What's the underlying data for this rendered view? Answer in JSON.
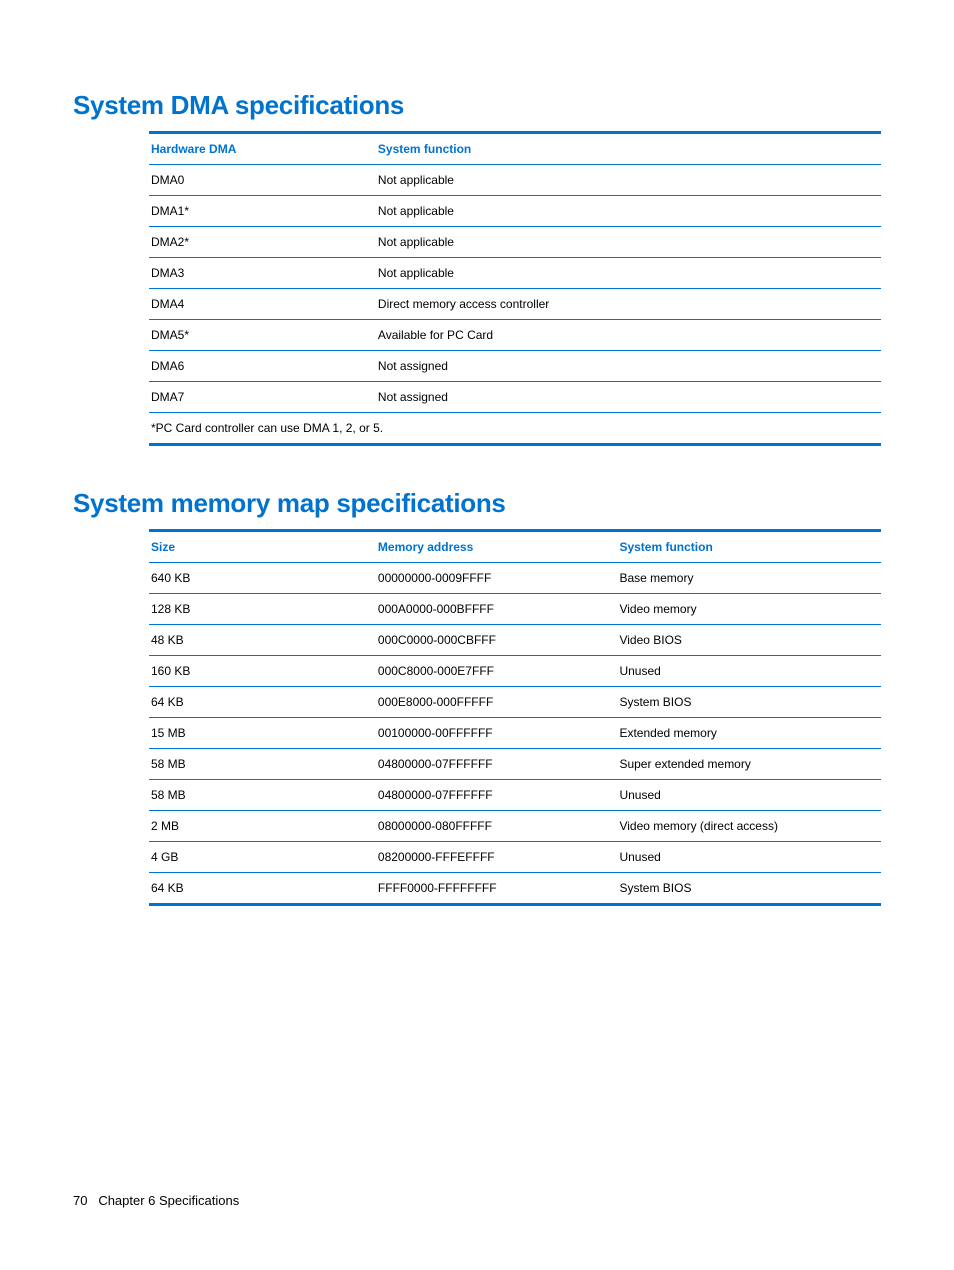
{
  "dma": {
    "title": "System DMA specifications",
    "headers": [
      "Hardware DMA",
      "System function"
    ],
    "rows": [
      [
        "DMA0",
        "Not applicable"
      ],
      [
        "DMA1*",
        "Not applicable"
      ],
      [
        "DMA2*",
        "Not applicable"
      ],
      [
        "DMA3",
        "Not applicable"
      ],
      [
        "DMA4",
        "Direct memory access controller"
      ],
      [
        "DMA5*",
        "Available for PC Card"
      ],
      [
        "DMA6",
        "Not assigned"
      ],
      [
        "DMA7",
        "Not assigned"
      ]
    ],
    "footnote": "*PC Card controller can use DMA 1, 2, or 5."
  },
  "memory": {
    "title": "System memory map specifications",
    "headers": [
      "Size",
      "Memory address",
      "System function"
    ],
    "rows": [
      [
        "640 KB",
        "00000000-0009FFFF",
        "Base memory"
      ],
      [
        "128 KB",
        "000A0000-000BFFFF",
        "Video memory"
      ],
      [
        "48 KB",
        "000C0000-000CBFFF",
        "Video BIOS"
      ],
      [
        "160 KB",
        "000C8000-000E7FFF",
        "Unused"
      ],
      [
        "64 KB",
        "000E8000-000FFFFF",
        "System BIOS"
      ],
      [
        "15 MB",
        "00100000-00FFFFFF",
        "Extended memory"
      ],
      [
        "58 MB",
        "04800000-07FFFFFF",
        "Super extended memory"
      ],
      [
        "58 MB",
        "04800000-07FFFFFF",
        "Unused"
      ],
      [
        "2 MB",
        "08000000-080FFFFF",
        "Video memory (direct access)"
      ],
      [
        "4 GB",
        "08200000-FFFEFFFF",
        "Unused"
      ],
      [
        "64 KB",
        "FFFF0000-FFFFFFFF",
        "System BIOS"
      ]
    ]
  },
  "footer": {
    "page_number": "70",
    "chapter": "Chapter 6   Specifications"
  }
}
